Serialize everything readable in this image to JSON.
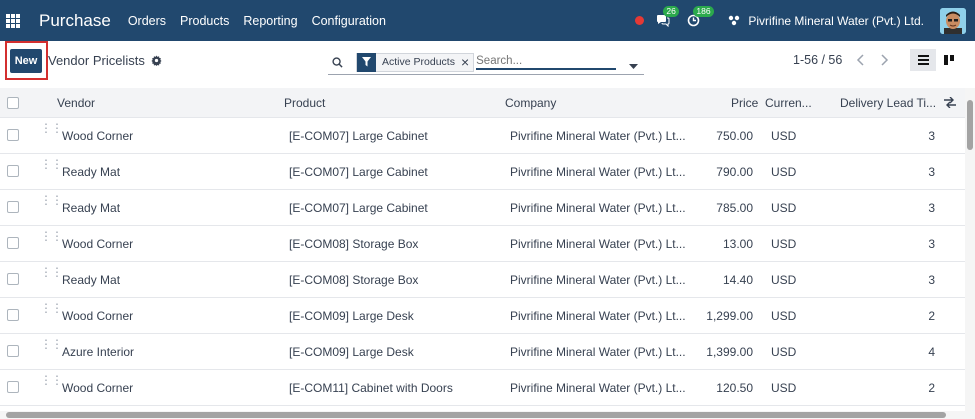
{
  "navbar": {
    "app_name": "Purchase",
    "menu": [
      "Orders",
      "Products",
      "Reporting",
      "Configuration"
    ],
    "messages_count": "26",
    "activities_count": "186",
    "company": "Pivrifine Mineral Water (Pvt.) Ltd."
  },
  "control": {
    "new_label": "New",
    "title": "Vendor Pricelists",
    "facet_label": "Active Products",
    "search_placeholder": "Search...",
    "pager": "1-56 / 56"
  },
  "table": {
    "headers": {
      "vendor": "Vendor",
      "product": "Product",
      "company": "Company",
      "price": "Price",
      "currency": "Curren...",
      "lead_time": "Delivery Lead Ti..."
    },
    "rows": [
      {
        "vendor": "Wood Corner",
        "product": "[E-COM07] Large Cabinet",
        "company": "Pivrifine Mineral Water (Pvt.) Lt...",
        "price": "750.00",
        "currency": "USD",
        "lead": "3"
      },
      {
        "vendor": "Ready Mat",
        "product": "[E-COM07] Large Cabinet",
        "company": "Pivrifine Mineral Water (Pvt.) Lt...",
        "price": "790.00",
        "currency": "USD",
        "lead": "3"
      },
      {
        "vendor": "Ready Mat",
        "product": "[E-COM07] Large Cabinet",
        "company": "Pivrifine Mineral Water (Pvt.) Lt...",
        "price": "785.00",
        "currency": "USD",
        "lead": "3"
      },
      {
        "vendor": "Wood Corner",
        "product": "[E-COM08] Storage Box",
        "company": "Pivrifine Mineral Water (Pvt.) Lt...",
        "price": "13.00",
        "currency": "USD",
        "lead": "3"
      },
      {
        "vendor": "Ready Mat",
        "product": "[E-COM08] Storage Box",
        "company": "Pivrifine Mineral Water (Pvt.) Lt...",
        "price": "14.40",
        "currency": "USD",
        "lead": "3"
      },
      {
        "vendor": "Wood Corner",
        "product": "[E-COM09] Large Desk",
        "company": "Pivrifine Mineral Water (Pvt.) Lt...",
        "price": "1,299.00",
        "currency": "USD",
        "lead": "2"
      },
      {
        "vendor": "Azure Interior",
        "product": "[E-COM09] Large Desk",
        "company": "Pivrifine Mineral Water (Pvt.) Lt...",
        "price": "1,399.00",
        "currency": "USD",
        "lead": "4"
      },
      {
        "vendor": "Wood Corner",
        "product": "[E-COM11] Cabinet with Doors",
        "company": "Pivrifine Mineral Water (Pvt.) Lt...",
        "price": "120.50",
        "currency": "USD",
        "lead": "2"
      }
    ]
  }
}
